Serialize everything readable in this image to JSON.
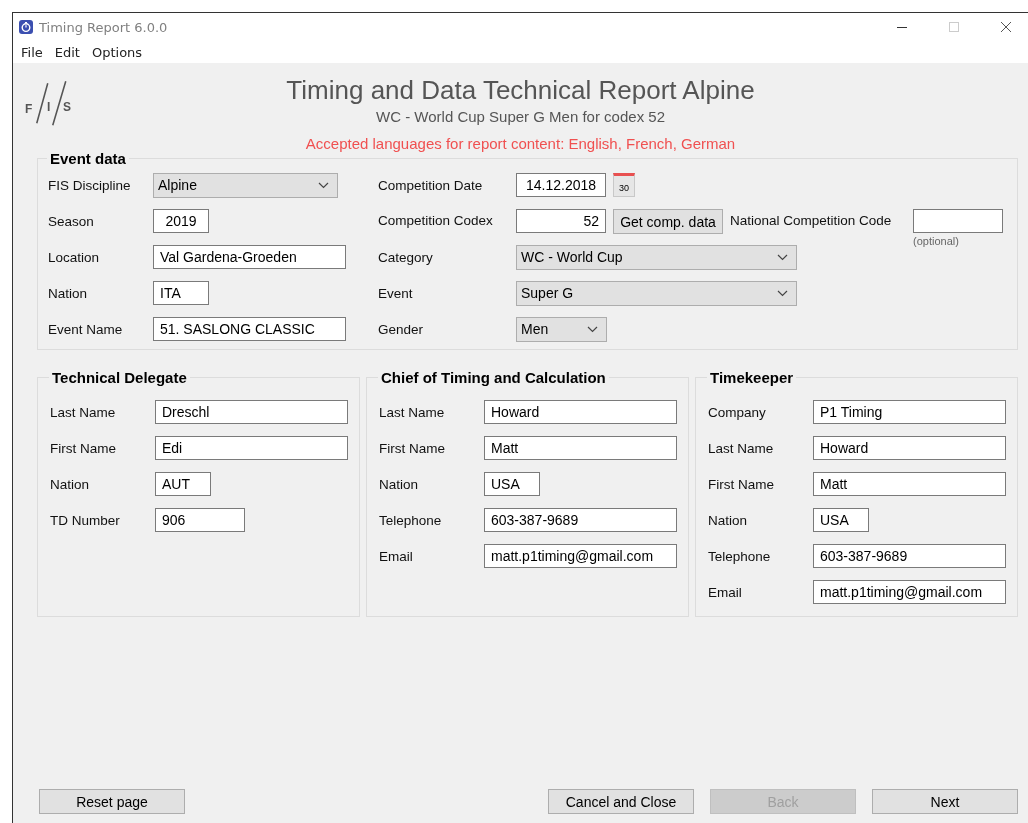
{
  "window": {
    "title": "Timing Report 6.0.0"
  },
  "menu": [
    "File",
    "Edit",
    "Options"
  ],
  "header": {
    "logo_letters": [
      "F",
      "I",
      "S"
    ],
    "title": "Timing and Data Technical Report Alpine",
    "subtitle": "WC - World Cup Super G Men for codex 52",
    "notice": "Accepted languages for report content: English, French, German"
  },
  "event_data": {
    "title": "Event data",
    "discipline": {
      "label": "FIS Discipline",
      "value": "Alpine"
    },
    "season": {
      "label": "Season",
      "value": "2019"
    },
    "location": {
      "label": "Location",
      "value": "Val Gardena-Groeden"
    },
    "nation": {
      "label": "Nation",
      "value": "ITA"
    },
    "event_name": {
      "label": "Event Name",
      "value": "51. SASLONG CLASSIC"
    },
    "competition_date": {
      "label": "Competition Date",
      "value": "14.12.2018",
      "calendar_day": "30"
    },
    "competition_codex": {
      "label": "Competition Codex",
      "value": "52",
      "button": "Get comp. data"
    },
    "national_competition_code": {
      "label": "National Competition Code",
      "hint": "(optional)"
    },
    "category": {
      "label": "Category",
      "value": "WC - World Cup"
    },
    "event": {
      "label": "Event",
      "value": "Super G"
    },
    "gender": {
      "label": "Gender",
      "value": "Men"
    }
  },
  "panels": [
    {
      "title": "Technical Delegate",
      "fields": [
        {
          "label": "Last Name",
          "value": "Dreschl",
          "kind": "long"
        },
        {
          "label": "First Name",
          "value": "Edi",
          "kind": "long"
        },
        {
          "label": "Nation",
          "value": "AUT",
          "kind": "short"
        },
        {
          "label": "TD Number",
          "value": "906",
          "kind": "medium"
        }
      ]
    },
    {
      "title": "Chief of Timing and Calculation",
      "fields": [
        {
          "label": "Last Name",
          "value": "Howard",
          "kind": "long"
        },
        {
          "label": "First Name",
          "value": "Matt",
          "kind": "long"
        },
        {
          "label": "Nation",
          "value": "USA",
          "kind": "short"
        },
        {
          "label": "Telephone",
          "value": "603-387-9689",
          "kind": "long"
        },
        {
          "label": "Email",
          "value": "matt.p1timing@gmail.com",
          "kind": "long"
        }
      ]
    },
    {
      "title": "Timekeeper",
      "fields": [
        {
          "label": "Company",
          "value": "P1 Timing",
          "kind": "long"
        },
        {
          "label": "Last Name",
          "value": "Howard",
          "kind": "long"
        },
        {
          "label": "First Name",
          "value": "Matt",
          "kind": "long"
        },
        {
          "label": "Nation",
          "value": "USA",
          "kind": "short"
        },
        {
          "label": "Telephone",
          "value": "603-387-9689",
          "kind": "long"
        },
        {
          "label": "Email",
          "value": "matt.p1timing@gmail.com",
          "kind": "long"
        }
      ]
    }
  ],
  "buttons": [
    {
      "label": "Reset page",
      "disabled": false
    },
    {
      "label": "Cancel and Close",
      "disabled": false
    },
    {
      "label": "Back",
      "disabled": true
    },
    {
      "label": "Next",
      "disabled": false
    }
  ]
}
